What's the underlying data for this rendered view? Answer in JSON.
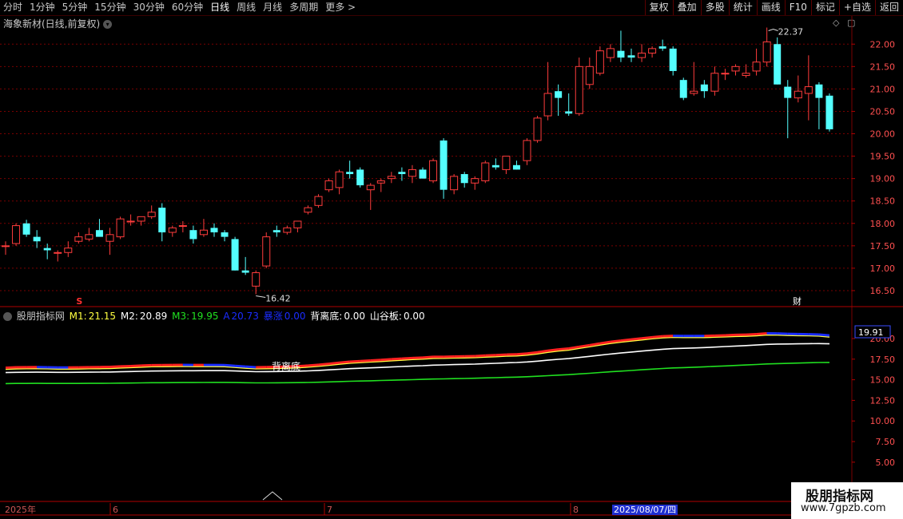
{
  "toolbar": {
    "periods": [
      "分时",
      "1分钟",
      "5分钟",
      "15分钟",
      "30分钟",
      "60分钟",
      "日线",
      "周线",
      "月线",
      "多周期",
      "更多 >"
    ],
    "active": "日线",
    "actions": [
      "复权",
      "叠加",
      "多股",
      "统计",
      "画线",
      "F10",
      "标记",
      "+自选",
      "返回"
    ]
  },
  "price_panel": {
    "title": "海象新材(日线,前复权)",
    "y_ticks": [
      "22.00",
      "21.50",
      "21.00",
      "20.50",
      "20.00",
      "19.50",
      "19.00",
      "18.50",
      "18.00",
      "17.50",
      "17.00",
      "16.50"
    ],
    "high_label": "22.37",
    "low_label": "16.42",
    "marker_s": "S",
    "marker_cai": "财"
  },
  "indicator_panel": {
    "name": "股朋指标网",
    "m1_label": "M1:",
    "m1_value": "21.15",
    "m2_label": "M2:",
    "m2_value": "20.89",
    "m3_label": "M3:",
    "m3_value": "19.95",
    "a_label": "A",
    "a_value": "20.73",
    "zs_label": "暴涨",
    "zs_value": "0.00",
    "bld_label": "背离底:",
    "bld_value": "0.00",
    "sgb_label": "山谷板:",
    "sgb_value": "0.00",
    "current_value": "19.91",
    "annotation": "背离底",
    "y_ticks": [
      "20.00",
      "17.50",
      "15.00",
      "12.50",
      "10.00",
      "7.50",
      "5.00"
    ]
  },
  "date_axis": {
    "labels": [
      "2025年",
      "6",
      "7",
      "8"
    ],
    "highlight": "2025/08/07/四"
  },
  "brand": {
    "name": "股朋指标网",
    "url": "www.7gpzb.com"
  },
  "colors": {
    "up": "#ff3c3c",
    "down": "#54ffff",
    "grid": "#7a0000",
    "m1": "#ff2020",
    "blue": "#1a2cff",
    "yellow": "#ffff40",
    "white": "#ffffff",
    "green": "#20e020"
  },
  "chart_data": {
    "type": "candlestick",
    "ylim": [
      16.25,
      22.45
    ],
    "candles": [
      {
        "o": 17.5,
        "h": 17.6,
        "l": 17.3,
        "c": 17.5
      },
      {
        "o": 17.55,
        "h": 18.0,
        "l": 17.5,
        "c": 17.95
      },
      {
        "o": 18.0,
        "h": 18.08,
        "l": 17.7,
        "c": 17.75
      },
      {
        "o": 17.7,
        "h": 17.85,
        "l": 17.45,
        "c": 17.6
      },
      {
        "o": 17.45,
        "h": 17.55,
        "l": 17.2,
        "c": 17.4
      },
      {
        "o": 17.35,
        "h": 17.4,
        "l": 17.15,
        "c": 17.35
      },
      {
        "o": 17.35,
        "h": 17.6,
        "l": 17.25,
        "c": 17.45
      },
      {
        "o": 17.6,
        "h": 17.8,
        "l": 17.55,
        "c": 17.7
      },
      {
        "o": 17.65,
        "h": 17.9,
        "l": 17.6,
        "c": 17.75
      },
      {
        "o": 17.85,
        "h": 18.1,
        "l": 17.75,
        "c": 17.7
      },
      {
        "o": 17.6,
        "h": 17.9,
        "l": 17.3,
        "c": 17.75
      },
      {
        "o": 17.7,
        "h": 18.15,
        "l": 17.65,
        "c": 18.1
      },
      {
        "o": 18.05,
        "h": 18.2,
        "l": 17.95,
        "c": 18.05
      },
      {
        "o": 18.05,
        "h": 18.15,
        "l": 17.95,
        "c": 18.15
      },
      {
        "o": 18.15,
        "h": 18.4,
        "l": 18.1,
        "c": 18.25
      },
      {
        "o": 18.35,
        "h": 18.45,
        "l": 17.6,
        "c": 17.8
      },
      {
        "o": 17.8,
        "h": 17.95,
        "l": 17.7,
        "c": 17.9
      },
      {
        "o": 17.95,
        "h": 18.05,
        "l": 17.8,
        "c": 17.95
      },
      {
        "o": 17.85,
        "h": 17.95,
        "l": 17.55,
        "c": 17.65
      },
      {
        "o": 17.75,
        "h": 18.1,
        "l": 17.7,
        "c": 17.85
      },
      {
        "o": 17.9,
        "h": 18.0,
        "l": 17.7,
        "c": 17.8
      },
      {
        "o": 17.8,
        "h": 17.85,
        "l": 17.6,
        "c": 17.7
      },
      {
        "o": 17.65,
        "h": 17.7,
        "l": 16.95,
        "c": 16.95
      },
      {
        "o": 16.95,
        "h": 17.25,
        "l": 16.85,
        "c": 16.9
      },
      {
        "o": 16.6,
        "h": 16.95,
        "l": 16.42,
        "c": 16.9
      },
      {
        "o": 17.05,
        "h": 17.8,
        "l": 17.0,
        "c": 17.7
      },
      {
        "o": 17.85,
        "h": 17.95,
        "l": 17.7,
        "c": 17.8
      },
      {
        "o": 17.8,
        "h": 17.95,
        "l": 17.75,
        "c": 17.9
      },
      {
        "o": 17.9,
        "h": 18.05,
        "l": 17.8,
        "c": 18.05
      },
      {
        "o": 18.25,
        "h": 18.4,
        "l": 18.2,
        "c": 18.35
      },
      {
        "o": 18.4,
        "h": 18.65,
        "l": 18.35,
        "c": 18.6
      },
      {
        "o": 18.75,
        "h": 19.0,
        "l": 18.7,
        "c": 18.95
      },
      {
        "o": 18.8,
        "h": 19.2,
        "l": 18.65,
        "c": 19.15
      },
      {
        "o": 19.15,
        "h": 19.4,
        "l": 19.0,
        "c": 19.1
      },
      {
        "o": 19.2,
        "h": 19.25,
        "l": 18.8,
        "c": 18.85
      },
      {
        "o": 18.75,
        "h": 18.9,
        "l": 18.3,
        "c": 18.85
      },
      {
        "o": 18.9,
        "h": 19.0,
        "l": 18.7,
        "c": 18.95
      },
      {
        "o": 19.0,
        "h": 19.15,
        "l": 18.9,
        "c": 19.05
      },
      {
        "o": 19.15,
        "h": 19.25,
        "l": 18.95,
        "c": 19.1
      },
      {
        "o": 19.05,
        "h": 19.3,
        "l": 18.9,
        "c": 19.2
      },
      {
        "o": 19.2,
        "h": 19.25,
        "l": 19.0,
        "c": 19.0
      },
      {
        "o": 18.95,
        "h": 19.45,
        "l": 18.9,
        "c": 19.4
      },
      {
        "o": 19.85,
        "h": 19.9,
        "l": 18.55,
        "c": 18.75
      },
      {
        "o": 18.75,
        "h": 19.1,
        "l": 18.65,
        "c": 19.05
      },
      {
        "o": 19.1,
        "h": 19.15,
        "l": 18.8,
        "c": 18.9
      },
      {
        "o": 18.9,
        "h": 19.05,
        "l": 18.75,
        "c": 19.0
      },
      {
        "o": 18.95,
        "h": 19.4,
        "l": 18.9,
        "c": 19.35
      },
      {
        "o": 19.3,
        "h": 19.45,
        "l": 19.2,
        "c": 19.25
      },
      {
        "o": 19.2,
        "h": 19.5,
        "l": 19.1,
        "c": 19.5
      },
      {
        "o": 19.3,
        "h": 19.4,
        "l": 19.2,
        "c": 19.2
      },
      {
        "o": 19.4,
        "h": 19.9,
        "l": 19.3,
        "c": 19.85
      },
      {
        "o": 19.85,
        "h": 20.4,
        "l": 19.8,
        "c": 20.35
      },
      {
        "o": 20.4,
        "h": 21.6,
        "l": 20.3,
        "c": 20.9
      },
      {
        "o": 20.95,
        "h": 21.1,
        "l": 20.4,
        "c": 20.8
      },
      {
        "o": 20.5,
        "h": 20.9,
        "l": 20.4,
        "c": 20.45
      },
      {
        "o": 20.45,
        "h": 21.7,
        "l": 20.4,
        "c": 21.5
      },
      {
        "o": 21.1,
        "h": 21.7,
        "l": 21.0,
        "c": 21.5
      },
      {
        "o": 21.35,
        "h": 21.95,
        "l": 21.3,
        "c": 21.85
      },
      {
        "o": 21.7,
        "h": 22.0,
        "l": 21.6,
        "c": 21.9
      },
      {
        "o": 21.85,
        "h": 22.3,
        "l": 21.6,
        "c": 21.7
      },
      {
        "o": 21.75,
        "h": 21.9,
        "l": 21.6,
        "c": 21.7
      },
      {
        "o": 21.7,
        "h": 22.0,
        "l": 21.6,
        "c": 21.8
      },
      {
        "o": 21.8,
        "h": 21.95,
        "l": 21.7,
        "c": 21.9
      },
      {
        "o": 21.95,
        "h": 22.1,
        "l": 21.85,
        "c": 21.9
      },
      {
        "o": 21.9,
        "h": 21.95,
        "l": 21.3,
        "c": 21.4
      },
      {
        "o": 21.2,
        "h": 21.25,
        "l": 20.75,
        "c": 20.8
      },
      {
        "o": 20.9,
        "h": 21.6,
        "l": 20.85,
        "c": 20.95
      },
      {
        "o": 21.1,
        "h": 21.2,
        "l": 20.8,
        "c": 20.95
      },
      {
        "o": 20.95,
        "h": 21.5,
        "l": 20.85,
        "c": 21.35
      },
      {
        "o": 21.35,
        "h": 21.45,
        "l": 21.2,
        "c": 21.35
      },
      {
        "o": 21.4,
        "h": 21.55,
        "l": 21.3,
        "c": 21.5
      },
      {
        "o": 21.3,
        "h": 21.55,
        "l": 21.25,
        "c": 21.35
      },
      {
        "o": 21.4,
        "h": 21.9,
        "l": 21.3,
        "c": 21.6
      },
      {
        "o": 21.6,
        "h": 22.37,
        "l": 21.5,
        "c": 22.05
      },
      {
        "o": 22.0,
        "h": 22.15,
        "l": 21.1,
        "c": 21.1
      },
      {
        "o": 21.05,
        "h": 21.2,
        "l": 19.9,
        "c": 20.8
      },
      {
        "o": 20.8,
        "h": 21.3,
        "l": 20.7,
        "c": 20.95
      },
      {
        "o": 20.9,
        "h": 21.75,
        "l": 20.3,
        "c": 21.05
      },
      {
        "o": 21.1,
        "h": 21.15,
        "l": 20.1,
        "c": 20.8
      },
      {
        "o": 20.85,
        "h": 20.9,
        "l": 20.05,
        "c": 20.1
      }
    ]
  }
}
